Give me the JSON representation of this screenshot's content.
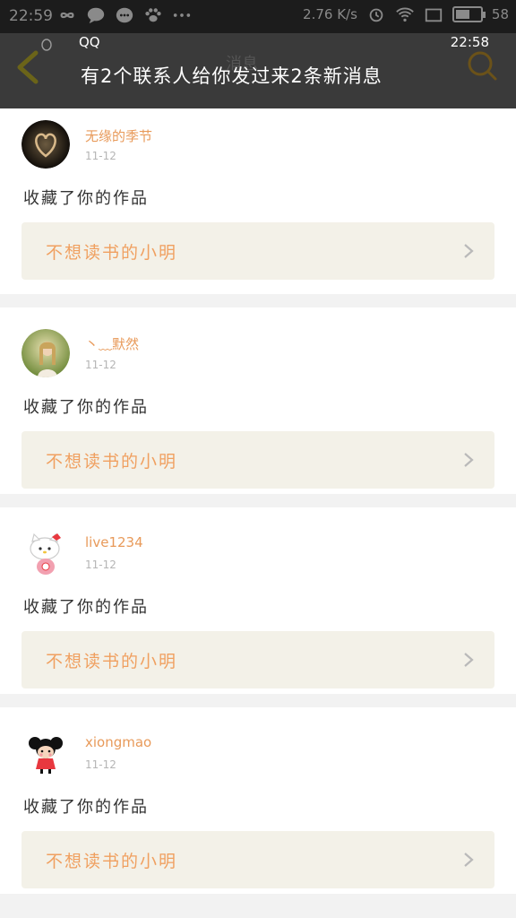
{
  "status_bar": {
    "time": "22:59",
    "speed": "2.76 K/s",
    "battery": "58",
    "battery_level": 0.58
  },
  "notification": {
    "app": "QQ",
    "time": "22:58",
    "text": "有2个联系人给你发过来2条新消息"
  },
  "header": {
    "title": "消息"
  },
  "items": [
    {
      "username": "无缘的季节",
      "date": "11-12",
      "action": "收藏了你的作品",
      "work": "不想读书的小明"
    },
    {
      "username": "丶﹏默然",
      "date": "11-12",
      "action": "收藏了你的作品",
      "work": "不想读书的小明"
    },
    {
      "username": "live1234",
      "date": "11-12",
      "action": "收藏了你的作品",
      "work": "不想读书的小明"
    },
    {
      "username": "xiongmao",
      "date": "11-12",
      "action": "收藏了你的作品",
      "work": "不想读书的小明"
    }
  ],
  "colors": {
    "accent": "#e89a5a",
    "header_bg": "#3a3a3a",
    "status_bg": "#1c1c1c",
    "work_bg": "#f3f1e8"
  }
}
